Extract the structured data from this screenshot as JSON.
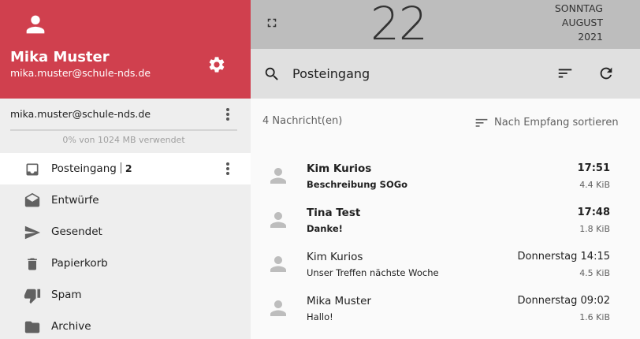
{
  "user": {
    "name": "Mika Muster",
    "email": "mika.muster@schule-nds.de",
    "avatar_icon": "person-icon",
    "settings_icon": "gear-icon"
  },
  "account": {
    "email": "mika.muster@schule-nds.de",
    "quota_text": "0% von 1024 MB verwendet",
    "quota_fraction": 0.0
  },
  "folders": [
    {
      "label": "Posteingang",
      "count": "2",
      "icon": "inbox-icon",
      "active": true
    },
    {
      "label": "Entwürfe",
      "icon": "drafts-icon"
    },
    {
      "label": "Gesendet",
      "icon": "send-icon"
    },
    {
      "label": "Papierkorb",
      "icon": "trash-icon"
    },
    {
      "label": "Spam",
      "icon": "thumbs-down-icon"
    },
    {
      "label": "Archive",
      "icon": "folder-icon"
    }
  ],
  "date": {
    "weekday": "SONNTAG",
    "month": "AUGUST",
    "year": "2021",
    "day": "22"
  },
  "mailbox": {
    "title": "Posteingang",
    "count_label": "4 Nachricht(en)",
    "sort_label": "Nach Empfang sortieren"
  },
  "messages": [
    {
      "sender": "Kim Kurios",
      "subject": "Beschreibung SOGo",
      "time": "17:51",
      "size": "4.4 KiB",
      "unread": true
    },
    {
      "sender": "Tina Test",
      "subject": "Danke!",
      "time": "17:48",
      "size": "1.8 KiB",
      "unread": true
    },
    {
      "sender": "Kim Kurios",
      "subject": "Unser Treffen nächste Woche",
      "time": "Donnerstag 14:15",
      "size": "4.5 KiB",
      "unread": false
    },
    {
      "sender": "Mika Muster",
      "subject": "Hallo!",
      "time": "Donnerstag 09:02",
      "size": "1.6 KiB",
      "unread": false
    }
  ],
  "colors": {
    "accent": "#d0404e",
    "sidebar_bg": "#eeeeee",
    "topbar_bg": "#bdbdbd",
    "header_bg": "#e0e0e0"
  }
}
